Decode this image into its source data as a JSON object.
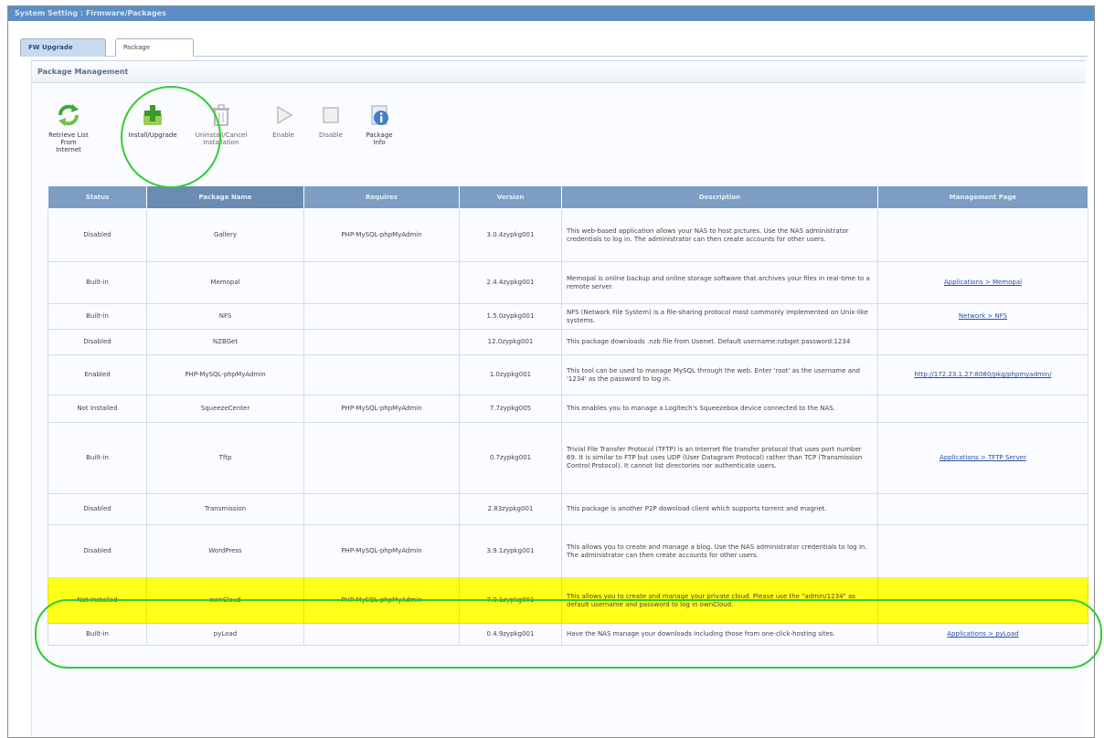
{
  "window": {
    "title": "System Setting : Firmware/Packages"
  },
  "tabs": [
    {
      "label": "FW Upgrade"
    },
    {
      "label": "Package"
    }
  ],
  "section": {
    "title": "Package Management"
  },
  "toolbar": {
    "buttons": [
      {
        "label": "Retrieve List From Internet",
        "icon": "refresh-icon"
      },
      {
        "label": "Install/Upgrade",
        "icon": "install-icon"
      },
      {
        "label": "Uninstall/Cancel Installation",
        "icon": "trash-icon"
      },
      {
        "label": "Enable",
        "icon": "play-icon"
      },
      {
        "label": "Disable",
        "icon": "stop-icon"
      },
      {
        "label": "Package Info",
        "icon": "info-icon"
      }
    ]
  },
  "table": {
    "columns": [
      "Status",
      "Package Name",
      "Requires",
      "Version",
      "Description",
      "Management Page"
    ],
    "rows": [
      {
        "status": "Disabled",
        "name": "Gallery",
        "requires": "PHP-MySQL-phpMyAdmin",
        "version": "3.0.4zypkg001",
        "description": "This web-based application allows your NAS to host pictures. Use the NAS administrator credentials to log in. The administrator can then create accounts for other users.",
        "page": ""
      },
      {
        "status": "Built-in",
        "name": "Memopal",
        "requires": "",
        "version": "2.4.4zypkg001",
        "description": "Memopal is online backup and online storage software that archives your files in real-time to a remote server.",
        "page": "Applications > Memopal"
      },
      {
        "status": "Built-in",
        "name": "NFS",
        "requires": "",
        "version": "1.5.0zypkg001",
        "description": "NFS (Network File System) is a file-sharing protocol most commonly implemented on Unix-like systems.",
        "page": "Network > NFS"
      },
      {
        "status": "Disabled",
        "name": "NZBGet",
        "requires": "",
        "version": "12.0zypkg001",
        "description": "This package downloads .nzb file from Usenet. Default username:nzbget password:1234",
        "page": ""
      },
      {
        "status": "Enabled",
        "name": "PHP-MySQL-phpMyAdmin",
        "requires": "",
        "version": "1.0zypkg001",
        "description": "This tool can be used to manage MySQL through the web. Enter 'root' as the username and '1234' as the password to log in.",
        "page": "http://172.23.1.27:8080/pkg/phpmyadmin/"
      },
      {
        "status": "Not Installed",
        "name": "SqueezeCenter",
        "requires": "PHP-MySQL-phpMyAdmin",
        "version": "7.7zypkg005",
        "description": "This enables you to manage a Logitech's Squeezebox device connected to the NAS.",
        "page": ""
      },
      {
        "status": "Built-in",
        "name": "Tftp",
        "requires": "",
        "version": "0.7zypkg001",
        "description": "Trivial File Transfer Protocol (TFTP) is an Internet file transfer protocol that uses port number 69. It is similar to FTP but uses UDP (User Datagram Protocol) rather than TCP (Transmission Control Protocol). It cannot list directories nor authenticate users.",
        "page": "Applications > TFTP Server"
      },
      {
        "status": "Disabled",
        "name": "Transmission",
        "requires": "",
        "version": "2.83zypkg001",
        "description": "This package is another P2P download client which supports torrent and magnet.",
        "page": ""
      },
      {
        "status": "Disabled",
        "name": "WordPress",
        "requires": "PHP-MySQL-phpMyAdmin",
        "version": "3.9.1zypkg001",
        "description": "This allows you to create and manage a blog. Use the NAS administrator credentials to log in. The administrator can then create accounts for other users.",
        "page": ""
      },
      {
        "status": "Not Installed",
        "name": "ownCloud",
        "requires": "PHP-MySQL-phpMyAdmin",
        "version": "7.0.1zypkg001",
        "description": "This allows you to create and manage your private cloud. Please use the \"admin/1234\" as default username and password to log in ownCloud.",
        "page": ""
      },
      {
        "status": "Built-in",
        "name": "pyLoad",
        "requires": "",
        "version": "0.4.9zypkg001",
        "description": "Have the NAS manage your downloads including those from one-click-hosting sites.",
        "page": "Applications > pyLoad"
      }
    ]
  },
  "colors": {
    "header_bg": "#7d9ec2",
    "highlight_row": "#ffff1a",
    "annotation": "#33cc33"
  }
}
